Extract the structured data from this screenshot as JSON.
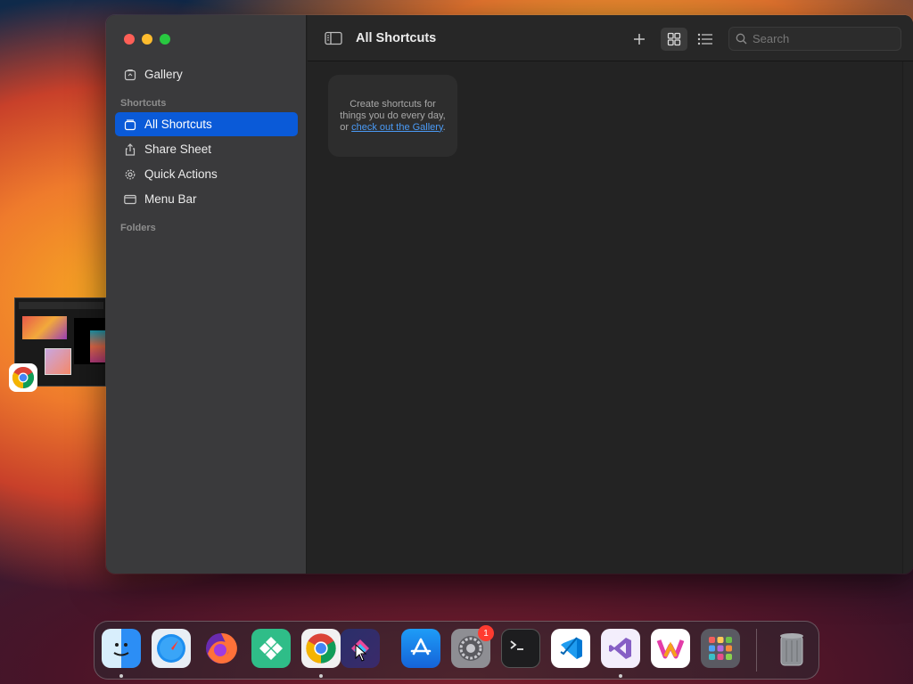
{
  "window": {
    "title": "All Shortcuts"
  },
  "sidebar": {
    "items": [
      {
        "label": "Gallery",
        "icon": "gallery-icon"
      },
      {
        "label": "All Shortcuts",
        "icon": "all-shortcuts-icon",
        "active": true
      },
      {
        "label": "Share Sheet",
        "icon": "share-icon"
      },
      {
        "label": "Quick Actions",
        "icon": "gear-icon"
      },
      {
        "label": "Menu Bar",
        "icon": "menubar-icon"
      }
    ],
    "section_shortcuts": "Shortcuts",
    "section_folders": "Folders"
  },
  "toolbar": {
    "search_placeholder": "Search"
  },
  "empty_state": {
    "text": "Create shortcuts for things you do every day, or",
    "link": "check out the Gallery",
    "suffix": "."
  },
  "dock": {
    "apps": [
      "Finder",
      "Safari",
      "Firefox",
      "Kolibri",
      "Chrome",
      "Shortcuts",
      "App Store",
      "System Settings",
      "Terminal",
      "Visual Studio Code",
      "Visual Studio",
      "Sketchbook",
      "Launchpad",
      "Trash"
    ],
    "system_settings_badge": "1"
  },
  "colors": {
    "accent": "#0a5ad8",
    "link": "#4a9af5"
  }
}
